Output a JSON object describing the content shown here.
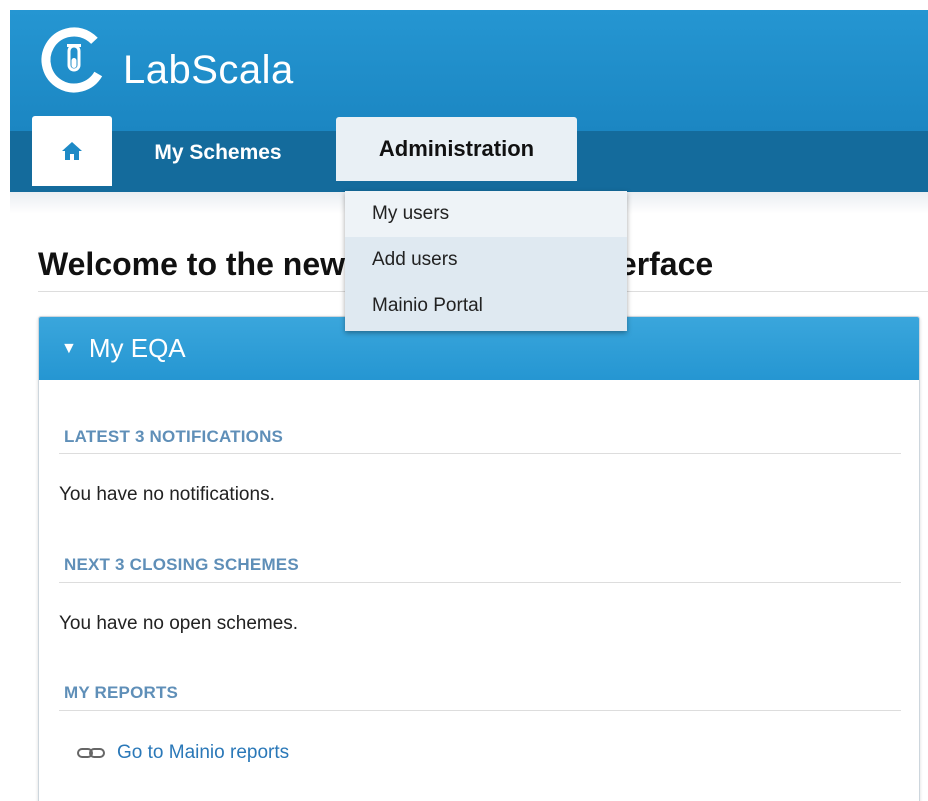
{
  "brand": {
    "name": "LabScala",
    "logo_icon": "labscala-logo-icon"
  },
  "nav": {
    "home_icon": "home-icon",
    "tabs": [
      {
        "label": "My Schemes"
      },
      {
        "label": "Administration"
      }
    ]
  },
  "dropdown": {
    "items": [
      {
        "label": "My users"
      },
      {
        "label": "Add users"
      },
      {
        "label": "Mainio Portal"
      }
    ]
  },
  "page": {
    "welcome": "Welcome to the new LabScala user interface"
  },
  "panel": {
    "title": "My EQA",
    "toggle_icon": "triangle-down-icon",
    "sections": [
      {
        "heading": "LATEST 3 NOTIFICATIONS",
        "text": "You have no notifications."
      },
      {
        "heading": "NEXT 3 CLOSING SCHEMES",
        "text": "You have no open schemes."
      },
      {
        "heading": "MY REPORTS"
      }
    ],
    "reports_link": {
      "label": "Go to Mainio reports",
      "icon": "link-icon"
    }
  },
  "colors": {
    "header": "#2596d2",
    "navbar": "#146b9c",
    "accent_heading": "#5f8fb8",
    "link": "#2a78b8"
  }
}
